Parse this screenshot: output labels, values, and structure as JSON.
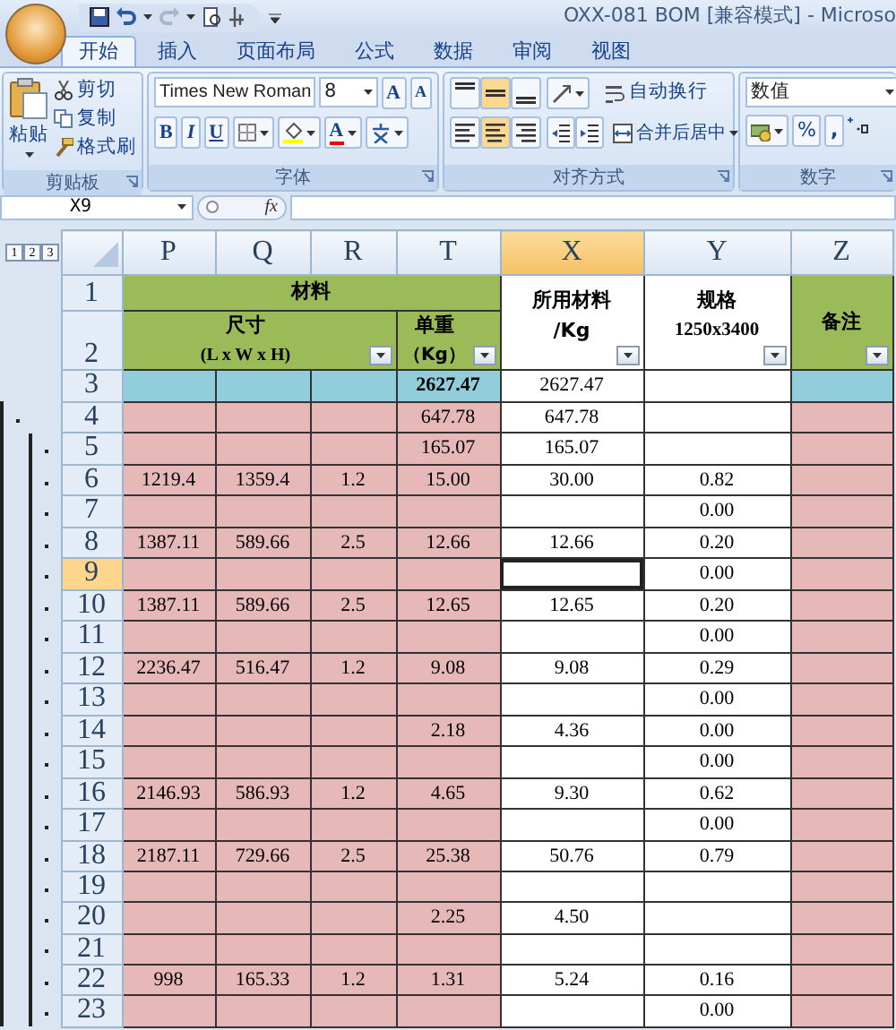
{
  "title_bar": {
    "title": "OXX-081 BOM  [兼容模式] - Microso"
  },
  "ribbon_tabs": [
    {
      "label": "开始",
      "selected": true
    },
    {
      "label": "插入",
      "selected": false
    },
    {
      "label": "页面布局",
      "selected": false
    },
    {
      "label": "公式",
      "selected": false
    },
    {
      "label": "数据",
      "selected": false
    },
    {
      "label": "审阅",
      "selected": false
    },
    {
      "label": "视图",
      "selected": false
    }
  ],
  "clipboard_group": {
    "label": "剪贴板",
    "paste": "粘贴",
    "cut": "剪切",
    "copy": "复制",
    "format_painter": "格式刷"
  },
  "font_group": {
    "label": "字体",
    "font_name": "Times New Roman",
    "font_size": "8",
    "grow_font": "A",
    "shrink_font": "A",
    "bold": "B",
    "italic": "I",
    "underline": "U",
    "font_color": "A"
  },
  "alignment_group": {
    "label": "对齐方式",
    "vertical_align_buttons": [
      {
        "selected": false
      },
      {
        "selected": true
      },
      {
        "selected": false
      }
    ],
    "horizontal_align_buttons": [
      {
        "selected": false
      },
      {
        "selected": true
      },
      {
        "selected": false
      }
    ],
    "wrap_text": "自动换行",
    "merge_center": "合并后居中"
  },
  "number_group": {
    "label": "数字",
    "format": "数值",
    "percent": "%",
    "comma": ","
  },
  "formula_bar": {
    "name_box": "X9",
    "fx": "fx"
  },
  "outline_levels": [
    "1",
    "2",
    "3"
  ],
  "columns": [
    {
      "label": "P",
      "selected": false
    },
    {
      "label": "Q",
      "selected": false
    },
    {
      "label": "R",
      "selected": false
    },
    {
      "label": "T",
      "selected": false
    },
    {
      "label": "X",
      "selected": true
    },
    {
      "label": "Y",
      "selected": false
    },
    {
      "label": "Z",
      "selected": false
    }
  ],
  "header_rows": {
    "numbers": [
      "1",
      "2"
    ],
    "material": "材料",
    "size": "尺寸",
    "size_unit": "(L x W x H)",
    "unit_weight": "单重",
    "unit_weight_unit": "（Kg）",
    "used_material": "所用材料",
    "used_material_unit": "/Kg",
    "spec": "规格",
    "spec_size": "1250x3400",
    "remarks": "备注"
  },
  "rows": [
    {
      "number": "3",
      "kind": "total",
      "selected": false,
      "cells": [
        null,
        null,
        null,
        "2627.47",
        "2627.47",
        null,
        null
      ]
    },
    {
      "number": "4",
      "kind": "group",
      "selected": false,
      "cells": [
        null,
        null,
        null,
        "647.78",
        "647.78",
        null,
        null
      ]
    },
    {
      "number": "5",
      "kind": "subgroup",
      "selected": false,
      "cells": [
        null,
        null,
        null,
        "165.07",
        "165.07",
        null,
        null
      ]
    },
    {
      "number": "6",
      "kind": "item",
      "selected": false,
      "cells": [
        "1219.4",
        "1359.4",
        "1.2",
        "15.00",
        "30.00",
        "0.82",
        null
      ]
    },
    {
      "number": "7",
      "kind": "item",
      "selected": false,
      "cells": [
        null,
        null,
        null,
        null,
        null,
        "0.00",
        null
      ]
    },
    {
      "number": "8",
      "kind": "item",
      "selected": false,
      "cells": [
        "1387.11",
        "589.66",
        "2.5",
        "12.66",
        "12.66",
        "0.20",
        null
      ]
    },
    {
      "number": "9",
      "kind": "item",
      "selected": true,
      "cells": [
        null,
        null,
        null,
        null,
        null,
        "0.00",
        null
      ]
    },
    {
      "number": "10",
      "kind": "item",
      "selected": false,
      "cells": [
        "1387.11",
        "589.66",
        "2.5",
        "12.65",
        "12.65",
        "0.20",
        null
      ]
    },
    {
      "number": "11",
      "kind": "item",
      "selected": false,
      "cells": [
        null,
        null,
        null,
        null,
        null,
        "0.00",
        null
      ]
    },
    {
      "number": "12",
      "kind": "item",
      "selected": false,
      "cells": [
        "2236.47",
        "516.47",
        "1.2",
        "9.08",
        "9.08",
        "0.29",
        null
      ]
    },
    {
      "number": "13",
      "kind": "item",
      "selected": false,
      "cells": [
        null,
        null,
        null,
        null,
        null,
        "0.00",
        null
      ]
    },
    {
      "number": "14",
      "kind": "item",
      "selected": false,
      "cells": [
        null,
        null,
        null,
        "2.18",
        "4.36",
        "0.00",
        null
      ]
    },
    {
      "number": "15",
      "kind": "item",
      "selected": false,
      "cells": [
        null,
        null,
        null,
        null,
        null,
        "0.00",
        null
      ]
    },
    {
      "number": "16",
      "kind": "item",
      "selected": false,
      "cells": [
        "2146.93",
        "586.93",
        "1.2",
        "4.65",
        "9.30",
        "0.62",
        null
      ]
    },
    {
      "number": "17",
      "kind": "item",
      "selected": false,
      "cells": [
        null,
        null,
        null,
        null,
        null,
        "0.00",
        null
      ]
    },
    {
      "number": "18",
      "kind": "item",
      "selected": false,
      "cells": [
        "2187.11",
        "729.66",
        "2.5",
        "25.38",
        "50.76",
        "0.79",
        null
      ]
    },
    {
      "number": "19",
      "kind": "item",
      "selected": false,
      "cells": [
        null,
        null,
        null,
        null,
        null,
        null,
        null
      ]
    },
    {
      "number": "20",
      "kind": "item",
      "selected": false,
      "cells": [
        null,
        null,
        null,
        "2.25",
        "4.50",
        null,
        null
      ]
    },
    {
      "number": "21",
      "kind": "item",
      "selected": false,
      "cells": [
        null,
        null,
        null,
        null,
        null,
        null,
        null
      ]
    },
    {
      "number": "22",
      "kind": "item",
      "selected": false,
      "cells": [
        "998",
        "165.33",
        "1.2",
        "1.31",
        "5.24",
        "0.16",
        null
      ]
    },
    {
      "number": "23",
      "kind": "item",
      "selected": false,
      "cells": [
        null,
        null,
        null,
        null,
        null,
        "0.00",
        null
      ]
    }
  ]
}
